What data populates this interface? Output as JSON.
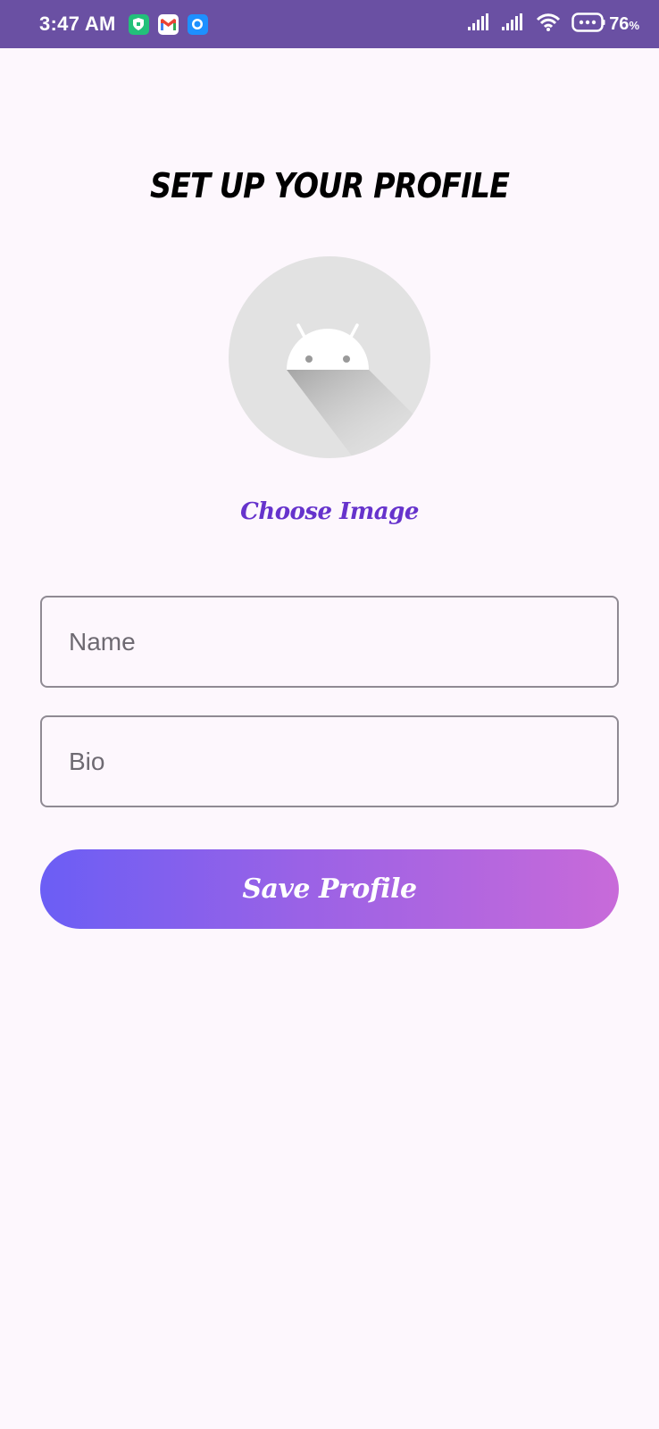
{
  "status_bar": {
    "time": "3:47 AM",
    "battery_percent": "76",
    "battery_unit": "%",
    "notification_icons": [
      "shield-app-icon",
      "gmail-icon",
      "messenger-icon"
    ],
    "system_icons": [
      "signal-icon",
      "signal-icon",
      "wifi-icon",
      "battery-icon"
    ],
    "background_color": "#6a50a3"
  },
  "page": {
    "title": "SET UP YOUR PROFILE",
    "avatar_icon": "android-placeholder-icon",
    "choose_image_label": "Choose Image",
    "accent_color": "#6633cc"
  },
  "form": {
    "name": {
      "placeholder": "Name",
      "value": ""
    },
    "bio": {
      "placeholder": "Bio",
      "value": ""
    },
    "save_label": "Save Profile",
    "button_gradient": [
      "#6b5ef5",
      "#c86ad9"
    ]
  }
}
